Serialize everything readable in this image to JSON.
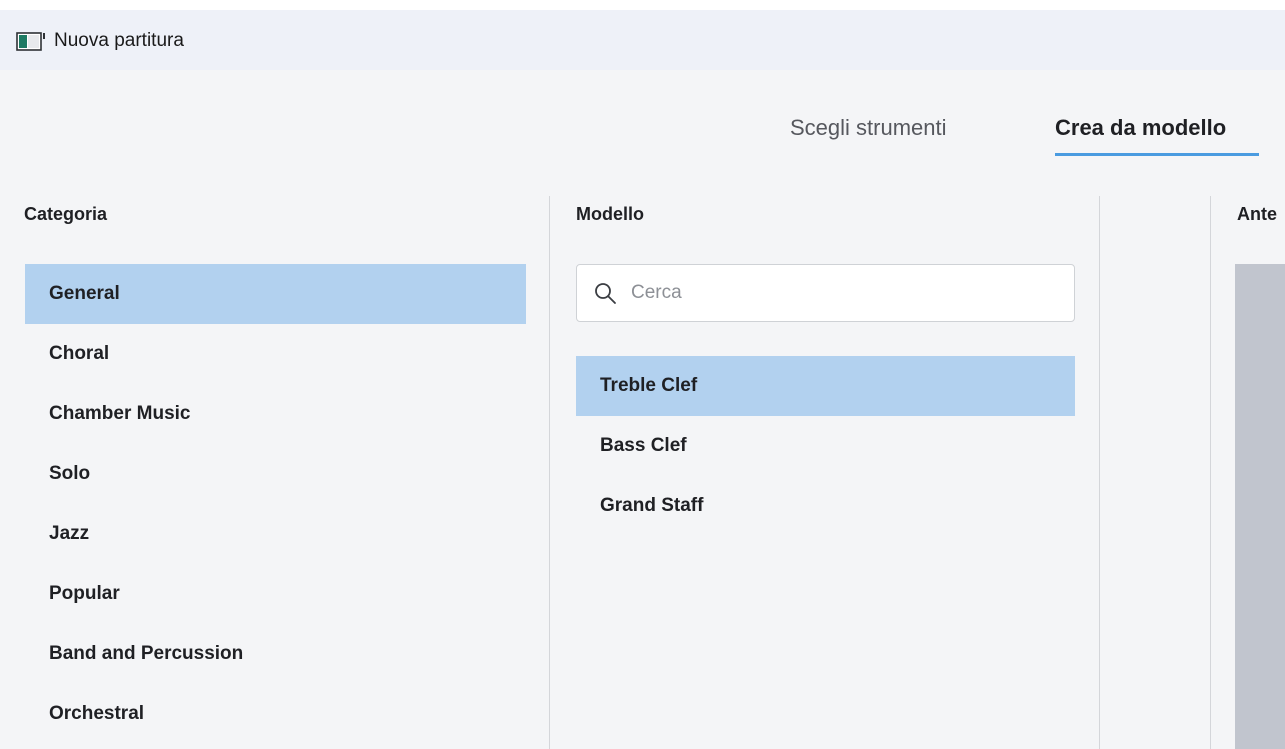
{
  "window": {
    "title": "Nuova partitura",
    "icon": "app-window-icon"
  },
  "tabs": [
    {
      "label": "Scegli strumenti",
      "active": false
    },
    {
      "label": "Crea da modello",
      "active": true
    }
  ],
  "colors": {
    "accent": "#4a9be0",
    "selection": "#b2d1ef",
    "preview_bg": "#c1c5ce"
  },
  "category": {
    "header": "Categoria",
    "items": [
      {
        "label": "General",
        "selected": true
      },
      {
        "label": "Choral",
        "selected": false
      },
      {
        "label": "Chamber Music",
        "selected": false
      },
      {
        "label": "Solo",
        "selected": false
      },
      {
        "label": "Jazz",
        "selected": false
      },
      {
        "label": "Popular",
        "selected": false
      },
      {
        "label": "Band and Percussion",
        "selected": false
      },
      {
        "label": "Orchestral",
        "selected": false
      }
    ]
  },
  "template": {
    "header": "Modello",
    "search": {
      "placeholder": "Cerca",
      "value": "",
      "icon": "search-icon"
    },
    "items": [
      {
        "label": "Treble Clef",
        "selected": true
      },
      {
        "label": "Bass Clef",
        "selected": false
      },
      {
        "label": "Grand Staff",
        "selected": false
      }
    ]
  },
  "preview": {
    "header": "Ante"
  }
}
